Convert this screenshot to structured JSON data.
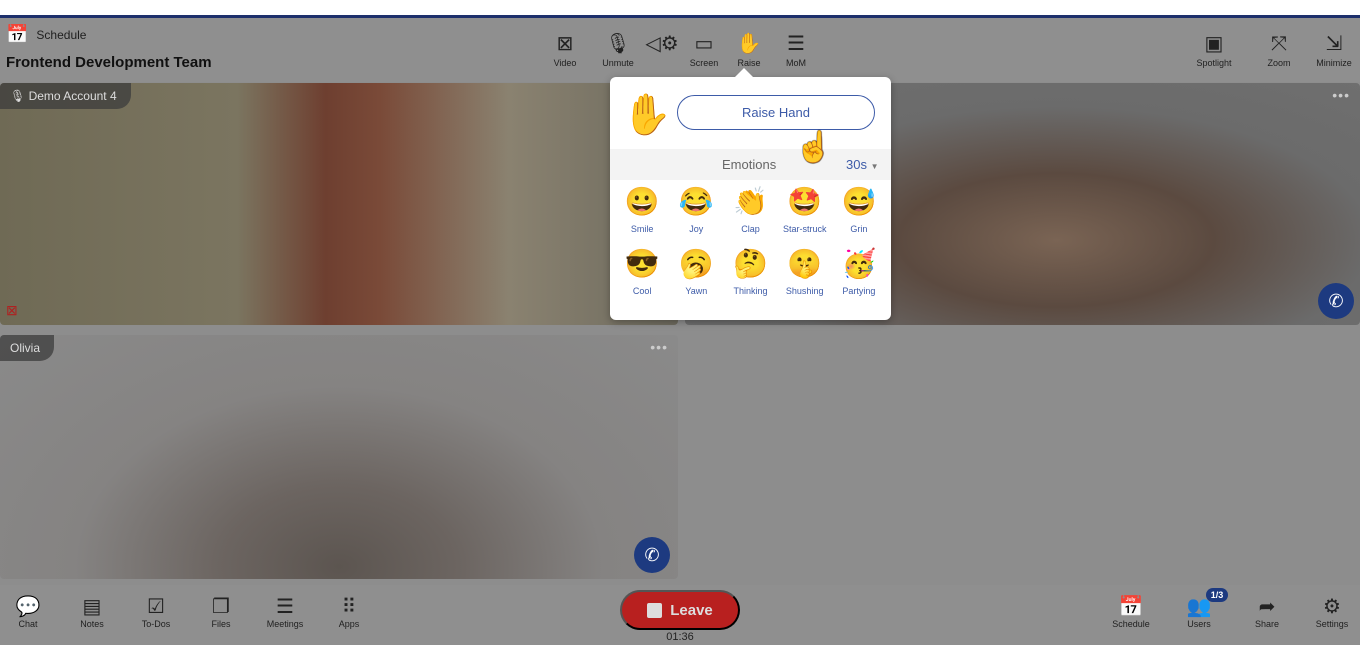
{
  "header": {
    "schedule_label": "Schedule",
    "meeting_title": "Frontend Development Team",
    "tools": [
      {
        "label": "Video",
        "icon": "video-off-icon"
      },
      {
        "label": "Unmute",
        "icon": "mic-off-icon"
      },
      {
        "label": "",
        "icon": "speaker-settings-icon"
      },
      {
        "label": "Screen",
        "icon": "screen-icon"
      },
      {
        "label": "Raise",
        "icon": "hand-icon"
      },
      {
        "label": "MoM",
        "icon": "list-icon"
      }
    ],
    "right_tools": [
      {
        "label": "Spotlight"
      },
      {
        "label": "Zoom"
      },
      {
        "label": "Minimize"
      }
    ]
  },
  "tiles": [
    {
      "name": "Demo Account 4",
      "muted": true,
      "camera_off": true
    },
    {
      "name": ""
    },
    {
      "name": "Olivia"
    }
  ],
  "popup": {
    "raise_hand_label": "Raise Hand",
    "emotions_label": "Emotions",
    "duration": "30s",
    "emotions": [
      {
        "glyph": "😀",
        "label": "Smile"
      },
      {
        "glyph": "😂",
        "label": "Joy"
      },
      {
        "glyph": "👏",
        "label": "Clap"
      },
      {
        "glyph": "🤩",
        "label": "Star-struck"
      },
      {
        "glyph": "😅",
        "label": "Grin"
      },
      {
        "glyph": "😎",
        "label": "Cool"
      },
      {
        "glyph": "🥱",
        "label": "Yawn"
      },
      {
        "glyph": "🤔",
        "label": "Thinking"
      },
      {
        "glyph": "🤫",
        "label": "Shushing"
      },
      {
        "glyph": "🥳",
        "label": "Partying"
      }
    ]
  },
  "footer": {
    "left": [
      {
        "label": "Chat"
      },
      {
        "label": "Notes"
      },
      {
        "label": "To-Dos"
      },
      {
        "label": "Files"
      },
      {
        "label": "Meetings"
      },
      {
        "label": "Apps"
      }
    ],
    "leave_label": "Leave",
    "timer": "01:36",
    "right": [
      {
        "label": "Schedule"
      },
      {
        "label": "Users"
      },
      {
        "label": "Share"
      },
      {
        "label": "Settings"
      }
    ],
    "users_badge": "1/3"
  },
  "colors": {
    "accent": "#3d5ba8",
    "leave": "#b8201f",
    "navy": "#1d3a80"
  }
}
